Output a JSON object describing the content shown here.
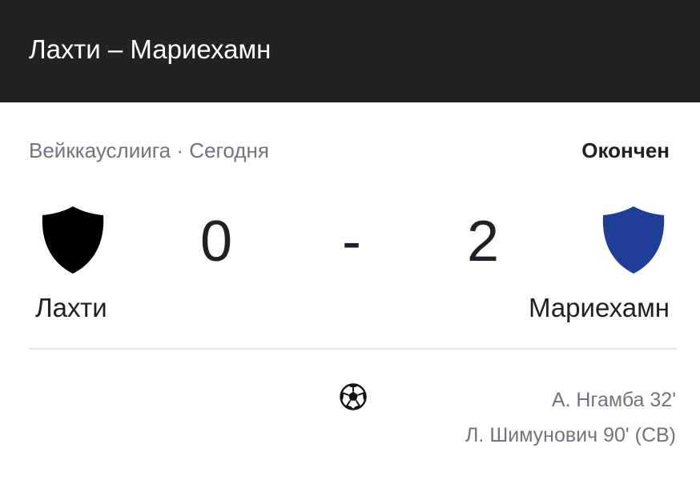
{
  "header": {
    "title": "Лахти – Мариехамн"
  },
  "match": {
    "league": "Вейккауслиига",
    "separator": "·",
    "date": "Сегодня",
    "status": "Окончен",
    "home": {
      "name": "Лахти",
      "score": "0",
      "crest_color": "#000000",
      "crest_icon": "shield-icon"
    },
    "away": {
      "name": "Мариехамн",
      "score": "2",
      "crest_color": "#1f3f97",
      "crest_icon": "shield-icon"
    },
    "score_separator": "-",
    "goals_icon": "soccer-ball-icon",
    "away_scorers": [
      "А. Нгамба 32'",
      "Л. Шимунович 90' (СВ)"
    ]
  }
}
